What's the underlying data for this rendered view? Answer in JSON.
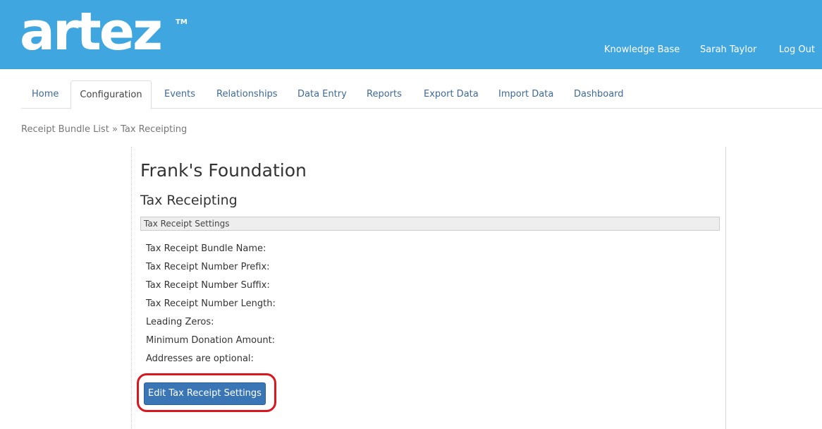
{
  "brand": {
    "logo_text": "artez",
    "trademark": "TM",
    "header_color": "#3fa6e0"
  },
  "header": {
    "links": {
      "knowledge_base": "Knowledge Base",
      "user_name": "Sarah Taylor",
      "logout": "Log Out"
    }
  },
  "nav": {
    "tabs": [
      {
        "label": "Home"
      },
      {
        "label": "Configuration",
        "active": true
      },
      {
        "label": "Events"
      },
      {
        "label": "Relationships"
      },
      {
        "label": "Data Entry"
      },
      {
        "label": "Reports"
      },
      {
        "label": "Export Data"
      },
      {
        "label": "Import Data"
      },
      {
        "label": "Dashboard"
      }
    ]
  },
  "breadcrumb": {
    "parent": "Receipt Bundle List",
    "separator": "»",
    "current": "Tax Receipting"
  },
  "main": {
    "org_name": "Frank's Foundation",
    "section_title": "Tax Receipting",
    "settings_header": "Tax Receipt Settings",
    "fields": [
      {
        "label": "Tax Receipt Bundle Name:"
      },
      {
        "label": "Tax Receipt Number Prefix:"
      },
      {
        "label": "Tax Receipt Number Suffix:"
      },
      {
        "label": "Tax Receipt Number Length:"
      },
      {
        "label": "Leading Zeros:"
      },
      {
        "label": "Minimum Donation Amount:"
      },
      {
        "label": "Addresses are optional:"
      }
    ],
    "edit_button_label": "Edit Tax Receipt Settings",
    "button_color": "#3a75b6",
    "highlight_color": "#d9171f"
  }
}
